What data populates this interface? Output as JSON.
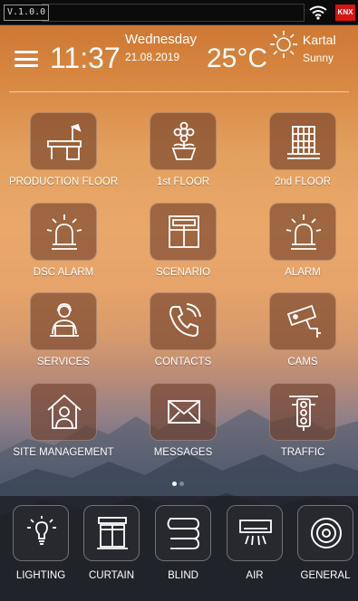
{
  "statusbar": {
    "version": "V.1.0.0",
    "knx_badge": "KNX",
    "icons": [
      "wifi-icon"
    ]
  },
  "header": {
    "time": "11:37",
    "day": "Wednesday",
    "date": "21.08.2019",
    "temperature": "25°C",
    "location": "Kartal",
    "condition": "Sunny",
    "icons": [
      "menu-icon",
      "sun-icon"
    ]
  },
  "grid": {
    "tiles": [
      {
        "label": "PRODUCTION FLOOR",
        "icon": "desk-lamp-icon"
      },
      {
        "label": "1st FLOOR",
        "icon": "flower-pot-icon"
      },
      {
        "label": "2nd FLOOR",
        "icon": "building-icon"
      },
      {
        "label": "DSC ALARM",
        "icon": "siren-icon"
      },
      {
        "label": "SCENARIO",
        "icon": "window-layout-icon"
      },
      {
        "label": "ALARM",
        "icon": "siren-icon"
      },
      {
        "label": "SERVICES",
        "icon": "support-person-icon"
      },
      {
        "label": "CONTACTS",
        "icon": "phone-icon"
      },
      {
        "label": "CAMS",
        "icon": "cctv-camera-icon"
      },
      {
        "label": "SITE MANAGEMENT",
        "icon": "house-person-icon"
      },
      {
        "label": "MESSAGES",
        "icon": "envelope-icon"
      },
      {
        "label": "TRAFFIC",
        "icon": "traffic-light-icon"
      }
    ]
  },
  "pager": {
    "pages": 2,
    "active": 1
  },
  "dock": {
    "items": [
      {
        "label": "LIGHTING",
        "icon": "bulb-icon"
      },
      {
        "label": "CURTAIN",
        "icon": "curtain-icon"
      },
      {
        "label": "BLIND",
        "icon": "blind-icon"
      },
      {
        "label": "AIR",
        "icon": "air-conditioner-icon"
      },
      {
        "label": "GENERAL",
        "icon": "target-icon"
      }
    ]
  },
  "colors": {
    "tile_bg": "#703e28",
    "knx_red": "#d61414",
    "dock_bg": "#1e1e22"
  }
}
